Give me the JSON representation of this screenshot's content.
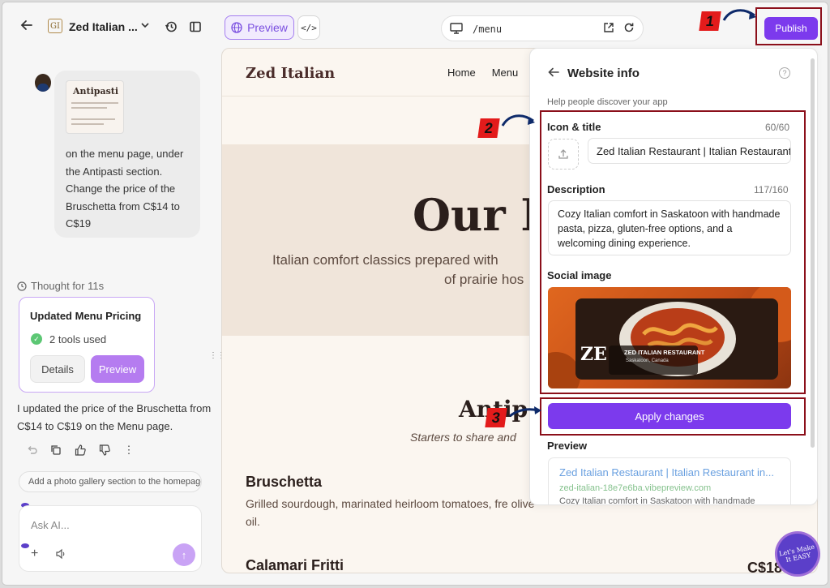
{
  "topbar": {
    "app_name": "Zed Italian ...",
    "logo_text": "GI",
    "preview_label": "Preview",
    "code_label": "</>",
    "url_path": "/menu",
    "publish_label": "Publish"
  },
  "markers": [
    "1",
    "2",
    "3"
  ],
  "chat": {
    "thumbnail_title": "Antipasti",
    "user_message": "on the menu page, under the Antipasti section. Change the price of the Bruschetta from C$14 to C$19",
    "thought": "Thought for 11s",
    "tool_card": {
      "title": "Updated Menu Pricing",
      "tools_used": "2 tools used",
      "details_label": "Details",
      "preview_label": "Preview"
    },
    "reply": "I updated the price of the Bruschetta from C$14 to C$19 on the Menu page.",
    "suggestion": "Add a photo gallery section to the homepage",
    "ask_placeholder": "Ask AI..."
  },
  "site": {
    "logo": "Zed Italian",
    "nav": [
      "Home",
      "Menu"
    ],
    "hero_title": "Our M",
    "hero_sub_line1": "Italian comfort classics prepared with",
    "hero_sub_line2": "of prairie hos",
    "section_title": "Antip",
    "section_sub": "Starters to share and",
    "items": [
      {
        "name": "Bruschetta",
        "description": "Grilled sourdough, marinated heirloom tomatoes, fre                        olive oil."
      },
      {
        "name": "Calamari Fritti",
        "price": "C$18"
      }
    ],
    "badge_text": "Let's Make It EASY"
  },
  "panel": {
    "title": "Website info",
    "subtitle": "Help people discover your app",
    "icon_title_label": "Icon & title",
    "icon_title_count": "60/60",
    "title_value": "Zed Italian Restaurant | Italian Restaurant in Saskatoon",
    "description_label": "Description",
    "description_count": "117/160",
    "description_value": "Cozy Italian comfort in Saskatoon with handmade pasta, pizza, gluten-free options, and a welcoming dining experience.",
    "social_image_label": "Social image",
    "social_image_caption": "ZED ITALIAN RESTAURANT",
    "social_image_subcaption": "Saskatoon, Canada",
    "apply_label": "Apply changes",
    "preview_label": "Preview",
    "preview_title": "Zed Italian Restaurant | Italian Restaurant in...",
    "preview_url": "zed-italian-18e7e6ba.vibepreview.com",
    "preview_desc": "Cozy Italian comfort in Saskatoon with handmade"
  },
  "colors": {
    "accent": "#7c3aed",
    "annotation_red": "#8b0f1a",
    "marker_red": "#e31b1b",
    "site_bg": "#fbf6f0"
  }
}
